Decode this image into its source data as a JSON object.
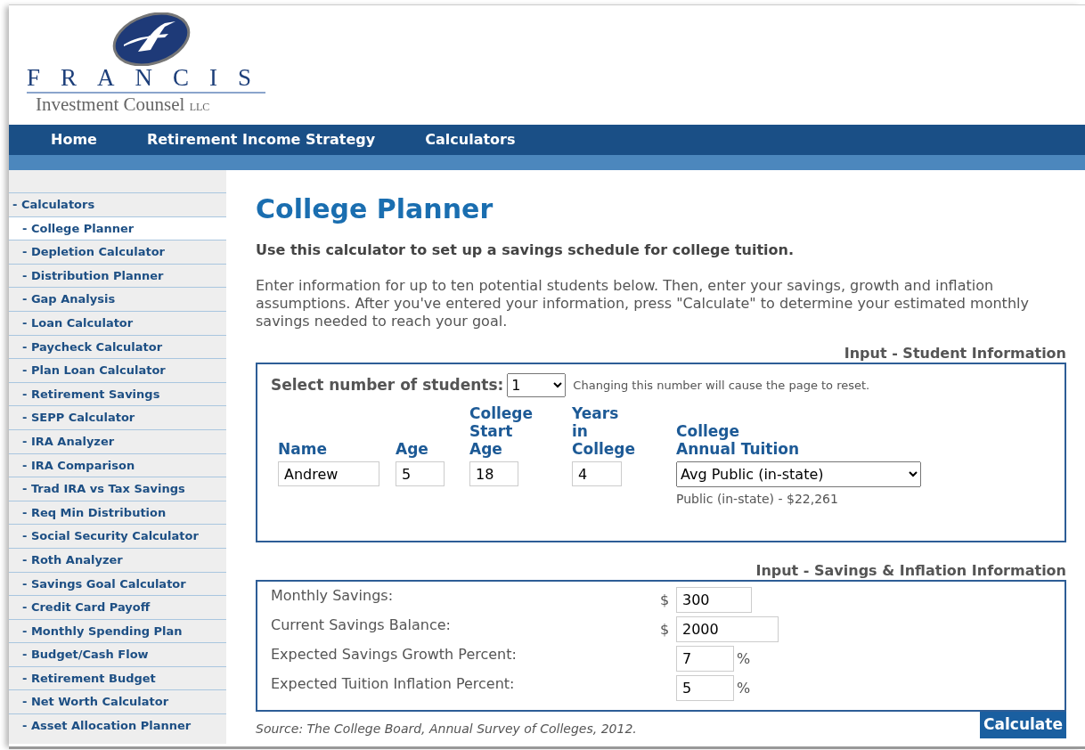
{
  "logo": {
    "name": "FRANCIS",
    "subtitle": "Investment Counsel",
    "suffix": "LLC"
  },
  "nav": [
    {
      "label": "Home"
    },
    {
      "label": "Retirement Income Strategy"
    },
    {
      "label": "Calculators"
    }
  ],
  "sidebar": {
    "items": [
      {
        "label": "- Calculators",
        "selected": false,
        "children": [
          {
            "label": "- College Planner",
            "selected": true
          },
          {
            "label": "- Depletion Calculator",
            "selected": false
          },
          {
            "label": "- Distribution Planner",
            "selected": false
          },
          {
            "label": "- Gap Analysis",
            "selected": false
          },
          {
            "label": "- Loan Calculator",
            "selected": false
          },
          {
            "label": "- Paycheck Calculator",
            "selected": false
          },
          {
            "label": "- Plan Loan Calculator",
            "selected": false
          },
          {
            "label": "- Retirement Savings",
            "selected": false
          },
          {
            "label": "- SEPP Calculator",
            "selected": false
          },
          {
            "label": "- IRA Analyzer",
            "selected": false
          },
          {
            "label": "- IRA Comparison",
            "selected": false
          },
          {
            "label": "- Trad IRA vs Tax Savings",
            "selected": false
          },
          {
            "label": "- Req Min Distribution",
            "selected": false
          },
          {
            "label": "- Social Security Calculator",
            "selected": false
          },
          {
            "label": "- Roth Analyzer",
            "selected": false
          },
          {
            "label": "- Savings Goal Calculator",
            "selected": false
          },
          {
            "label": "- Credit Card Payoff",
            "selected": false
          },
          {
            "label": "- Monthly Spending Plan",
            "selected": false
          },
          {
            "label": "- Budget/Cash Flow",
            "selected": false
          },
          {
            "label": "- Retirement Budget",
            "selected": false
          },
          {
            "label": "- Net Worth Calculator",
            "selected": false
          },
          {
            "label": "- Asset Allocation Planner",
            "selected": false
          }
        ]
      }
    ]
  },
  "content": {
    "title": "College Planner",
    "lead": "Use this calculator to set up a savings schedule for college tuition.",
    "intro": "Enter information for up to ten potential students below. Then, enter your savings, growth and inflation assumptions. After you've entered your information, press \"Calculate\" to determine your estimated monthly savings needed to reach your goal.",
    "student_section": {
      "heading": "Input - Student Information",
      "select_label": "Select number of students:",
      "count": "1",
      "note": "Changing this number will cause the page to reset.",
      "columns": [
        "Name",
        "Age",
        "College\nStart\nAge",
        "Years\nin\nCollege",
        "College\nAnnual Tuition"
      ],
      "rows": [
        {
          "name": "Andrew",
          "age": "5",
          "start_age": "18",
          "years": "4",
          "tuition": "Avg Public (in-state)",
          "tuition_note": "Public (in-state) - $22,261"
        }
      ]
    },
    "savings_section": {
      "heading": "Input - Savings & Inflation Information",
      "fields": [
        {
          "label": "Monthly Savings:",
          "prefix": "$",
          "value": "300"
        },
        {
          "label": "Current Savings Balance:",
          "prefix": "$",
          "value": "2000"
        },
        {
          "label": "Expected Savings Growth Percent:",
          "value": "7",
          "suffix": "%"
        },
        {
          "label": "Expected Tuition Inflation Percent:",
          "value": "5",
          "suffix": "%"
        }
      ]
    },
    "source": "Source: The College Board, Annual Survey of Colleges, 2012.",
    "button": "Calculate"
  }
}
